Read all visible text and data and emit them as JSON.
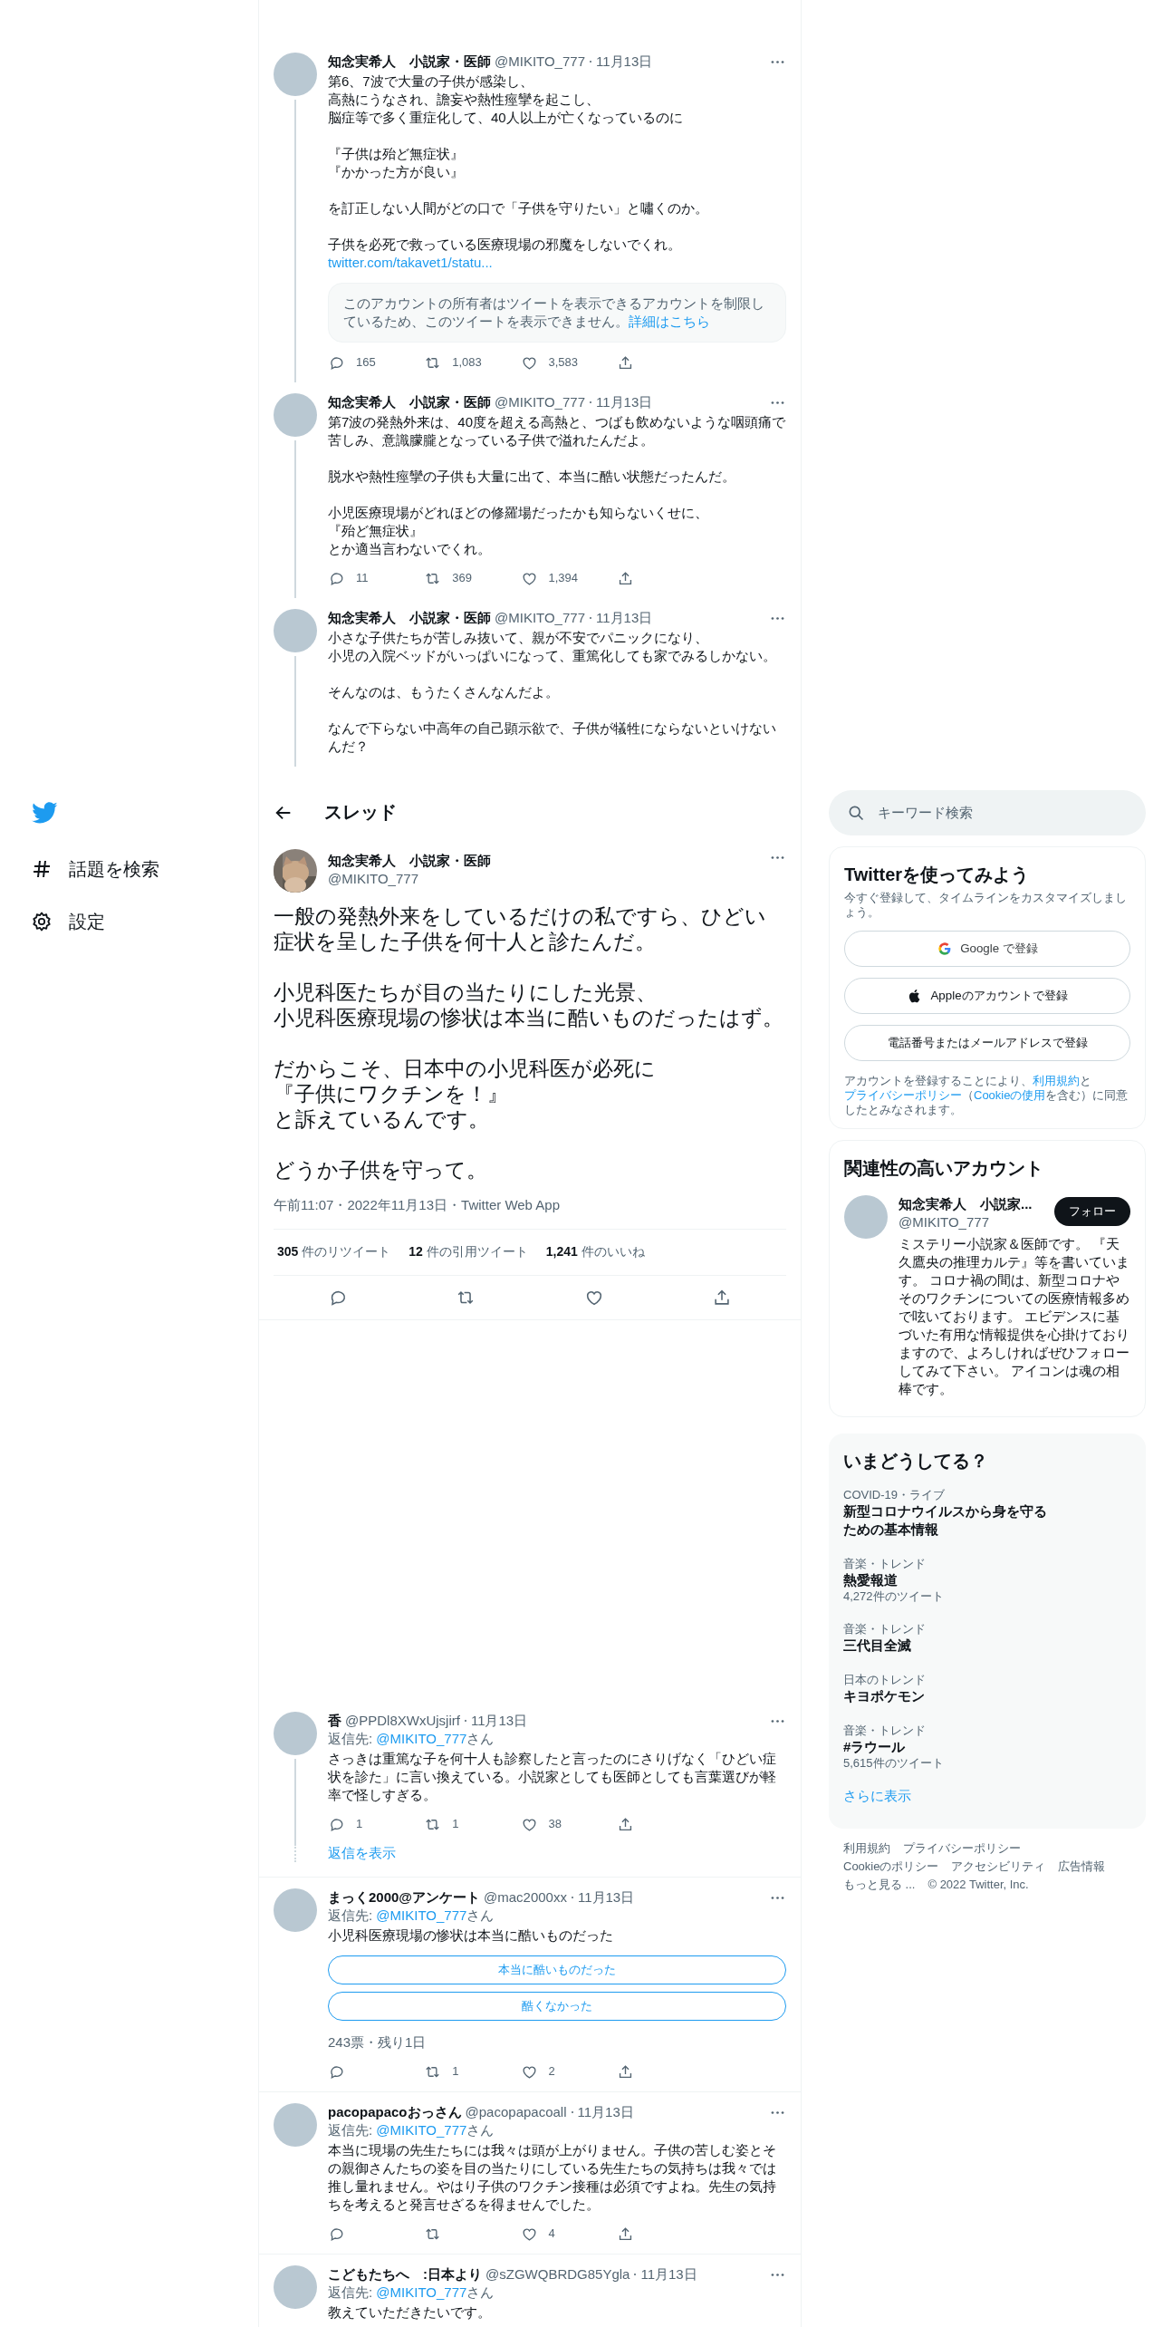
{
  "nav": {
    "items": [
      {
        "kind": "explore",
        "label": "話題を検索"
      },
      {
        "kind": "settings",
        "label": "設定"
      }
    ]
  },
  "thread": [
    {
      "name": "知念実希人　小説家・医師",
      "handle": "@MIKITO_777",
      "date": "11月13日",
      "paragraphs": [
        [
          "第6、7波で大量の子供が感染し、",
          "高熱にうなされ、譫妄や熱性痙攣を起こし、",
          "脳症等で多く重症化して、40人以上が亡くなっているのに"
        ],
        [
          "『子供は殆ど無症状』",
          "『かかった方が良い』"
        ],
        [
          "を訂正しない人間がどの口で「子供を守りたい」と嘯くのか。"
        ],
        [
          "子供を必死で救っている医療現場の邪魔をしないでくれ。"
        ]
      ],
      "link": "twitter.com/takavet1/statu...",
      "notice": {
        "text": "このアカウントの所有者はツイートを表示できるアカウントを制限しているため、このツイートを表示できません。",
        "link": "詳細はこちら"
      },
      "actions": {
        "replies": "165",
        "retweets": "1,083",
        "likes": "3,583"
      },
      "thread_line": true
    },
    {
      "name": "知念実希人　小説家・医師",
      "handle": "@MIKITO_777",
      "date": "11月13日",
      "paragraphs": [
        [
          "第7波の発熱外来は、40度を超える高熱と、つばも飲めないような咽頭痛で苦しみ、意識朦朧となっている子供で溢れたんだよ。"
        ],
        [
          "脱水や熱性痙攣の子供も大量に出て、本当に酷い状態だったんだ。"
        ],
        [
          "小児医療現場がどれほどの修羅場だったかも知らないくせに、",
          "『殆ど無症状』",
          "とか適当言わないでくれ。"
        ]
      ],
      "actions": {
        "replies": "11",
        "retweets": "369",
        "likes": "1,394"
      },
      "thread_line": true
    },
    {
      "name": "知念実希人　小説家・医師",
      "handle": "@MIKITO_777",
      "date": "11月13日",
      "paragraphs": [
        [
          "小さな子供たちが苦しみ抜いて、親が不安でパニックになり、",
          "小児の入院ベッドがいっぱいになって、重篤化しても家でみるしかない。"
        ],
        [
          "そんなのは、もうたくさんなんだよ。"
        ],
        [
          "なんで下らない中高年の自己顕示欲で、子供が犠牲にならないといけないんだ？"
        ]
      ],
      "thread_line": true
    }
  ],
  "header": {
    "title": "スレッド"
  },
  "main": {
    "name": "知念実希人　小説家・医師",
    "handle": "@MIKITO_777",
    "paragraphs": [
      [
        "一般の発熱外来をしているだけの私ですら、ひどい症状を呈した子供を何十人と診たんだ。"
      ],
      [
        "小児科医たちが目の当たりにした光景、",
        "小児科医療現場の惨状は本当に酷いものだったはず。"
      ],
      [
        "だからこそ、日本中の小児科医が必死に",
        "『子供にワクチンを！』",
        "と訴えているんです。"
      ],
      [
        "どうか子供を守って。"
      ]
    ],
    "meta": "午前11:07・2022年11月13日・Twitter Web App",
    "stats": [
      "**305** 件のリツイート",
      "**12** 件の引用ツイート",
      "**1,241** 件のいいね"
    ]
  },
  "replies": [
    {
      "name": "香",
      "handle": "@PPDl8XWxUjsjirf",
      "date": "11月13日",
      "reply_to": {
        "label": "返信先:",
        "mention": "@MIKITO_777",
        "suffix": "さん"
      },
      "paragraphs": [
        [
          "さっきは重篤な子を何十人も診察したと言ったのにさりげなく「ひどい症状を診た」に言い換えている。小説家としても医師としても言葉選びが軽率で怪しすぎる。"
        ]
      ],
      "actions": {
        "replies": "1",
        "retweets": "1",
        "likes": "38"
      },
      "thread_line": true,
      "show_replies": "返信を表示"
    },
    {
      "name": "まっく2000@アンケート",
      "handle": "@mac2000xx",
      "date": "11月13日",
      "reply_to": {
        "label": "返信先:",
        "mention": "@MIKITO_777",
        "suffix": "さん"
      },
      "paragraphs": [
        [
          "小児科医療現場の惨状は本当に酷いものだった"
        ]
      ],
      "poll": {
        "options": [
          "本当に酷いものだった",
          "酷くなかった"
        ],
        "meta": "243票・残り1日"
      },
      "actions": {
        "retweets": "1",
        "likes": "2"
      },
      "thread_line": false
    },
    {
      "name": "pacopapacoおっさん",
      "handle": "@pacopapacoall",
      "date": "11月13日",
      "reply_to": {
        "label": "返信先:",
        "mention": "@MIKITO_777",
        "suffix": "さん"
      },
      "paragraphs": [
        [
          "本当に現場の先生たちには我々は頭が上がりません。子供の苦しむ姿とその親御さんたちの姿を目の当たりにしている先生たちの気持ちは我々では推し量れません。やはり子供のワクチン接種は必須ですよね。先生の気持ちを考えると発言せざるを得ませんでした。"
        ]
      ],
      "actions": {
        "likes": "4"
      },
      "thread_line": false
    },
    {
      "name": "こどもたちへ　:日本より",
      "handle": "@sZGWQBRDG85Ygla",
      "date": "11月13日",
      "reply_to": {
        "label": "返信先:",
        "mention": "@MIKITO_777",
        "suffix": "さん"
      },
      "paragraphs": [
        [
          "教えていただきたいです。"
        ]
      ],
      "thread_line": false
    }
  ],
  "sidebar": {
    "search": {
      "placeholder": "キーワード検索"
    },
    "signup": {
      "title": "Twitterを使ってみよう",
      "subtitle": "今すぐ登録して、タイムラインをカスタマイズしましょう。",
      "buttons": [
        {
          "kind": "google",
          "label": "Google で登録"
        },
        {
          "kind": "apple",
          "label": "Appleのアカウントで登録"
        },
        {
          "kind": "phone",
          "label": "電話番号またはメールアドレスで登録"
        }
      ],
      "terms": [
        {
          "text": "アカウントを登録することにより、",
          "link": false
        },
        {
          "text": "利用規約",
          "link": true
        },
        {
          "text": "と",
          "link": false
        },
        {
          "text": "プライバシーポリシー",
          "link": true
        },
        {
          "text": "（",
          "link": false
        },
        {
          "text": "Cookieの使用",
          "link": true
        },
        {
          "text": "を含む）に同意したとみなされます。",
          "link": false
        }
      ]
    },
    "related": {
      "title": "関連性の高いアカウント",
      "name": "知念実希人　小説家...",
      "handle": "@MIKITO_777",
      "button": "フォロー",
      "bio": "ミステリー小説家＆医師です。 『天久鷹央の推理カルテ』等を書いています。 コロナ禍の間は、新型コロナやそのワクチンについての医療情報多めで呟いております。 エビデンスに基づいた有用な情報提供を心掛けておりますので、よろしければぜひフォローしてみて下さい。 アイコンは魂の相棒です。"
    },
    "trends": {
      "title": "いまどうしてる？",
      "items": [
        {
          "category": "COVID-19・ライブ",
          "title": "新型コロナウイルスから身を守るための基本情報"
        },
        {
          "category": "音楽・トレンド",
          "title": "熱愛報道",
          "count": "4,272件のツイート"
        },
        {
          "category": "音楽・トレンド",
          "title": "三代目全滅"
        },
        {
          "category": "日本のトレンド",
          "title": "キヨポケモン"
        },
        {
          "category": "音楽・トレンド",
          "title": "#ラウール",
          "count": "5,615件のツイート"
        }
      ],
      "more": "さらに表示"
    },
    "footer": [
      "利用規約",
      "プライバシーポリシー",
      "Cookieのポリシー",
      "アクセシビリティ",
      "広告情報",
      "もっと見る ...",
      "© 2022 Twitter, Inc."
    ]
  }
}
